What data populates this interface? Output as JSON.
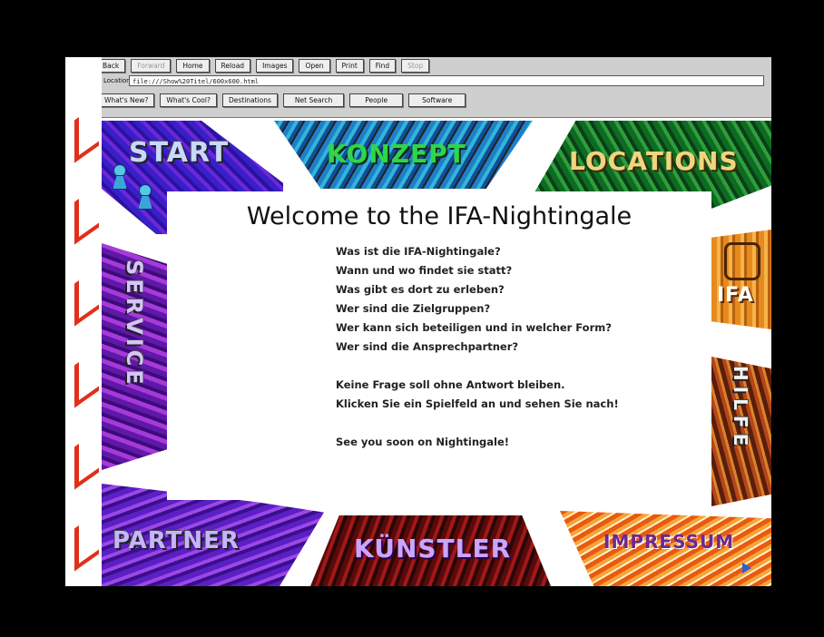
{
  "toolbar": {
    "buttons": [
      "Back",
      "Forward",
      "Home",
      "Reload",
      "Images",
      "Open",
      "Print",
      "Find",
      "Stop"
    ]
  },
  "location": {
    "label": "Location:",
    "url": "file:///Show%20Titel/600x600.html"
  },
  "directory": {
    "buttons": [
      "What's New?",
      "What's Cool?",
      "Destinations",
      "Net Search",
      "People",
      "Software"
    ]
  },
  "tiles": {
    "start": "START",
    "konzept": "KONZEPT",
    "locations": "LOCATIONS",
    "service": "SERVICE",
    "ifa": "IFA",
    "hilfe": "HILFE",
    "partner": "PARTNER",
    "kuenstler": "KÜNSTLER",
    "impressum": "IMPRESSUM"
  },
  "welcome": {
    "title": "Welcome to the IFA-Nightingale",
    "questions": [
      "Was ist die IFA-Nightingale?",
      "Wann und wo findet sie statt?",
      "Was gibt es dort zu erleben?",
      "Wer sind die Zielgruppen?",
      "Wer kann sich beteiligen und in welcher Form?",
      "Wer sind die Ansprechpartner?"
    ],
    "closing1": "Keine Frage soll ohne Antwort bleiben.",
    "closing2": "Klicken Sie ein Spielfeld an und sehen Sie nach!",
    "signoff": "See you soon on Nightingale!"
  },
  "colors": {
    "binding_red": "#e0301a",
    "frame": "#000000"
  },
  "icons": [
    "pawn-icon",
    "ifa-face-icon",
    "play-arrow-icon"
  ]
}
